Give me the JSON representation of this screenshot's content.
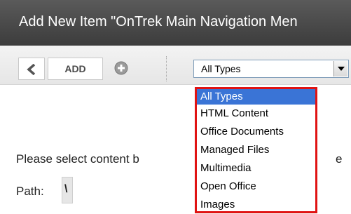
{
  "window": {
    "title": "Add New Item \"OnTrek Main Navigation Men"
  },
  "toolbar": {
    "back_icon": "chevron-left-icon",
    "add_label": "ADD",
    "plus_icon": "add-circle-icon"
  },
  "type_select": {
    "value": "All Types",
    "options": [
      "All Types",
      "HTML Content",
      "Office Documents",
      "Managed Files",
      "Multimedia",
      "Open Office",
      "Images"
    ],
    "highlight_color": "#e01313",
    "selected_bg": "#3a74d6"
  },
  "content": {
    "instruction": "Please select content b",
    "instruction_suffix": "e",
    "path_label": "Path:",
    "path_value": "\\"
  }
}
